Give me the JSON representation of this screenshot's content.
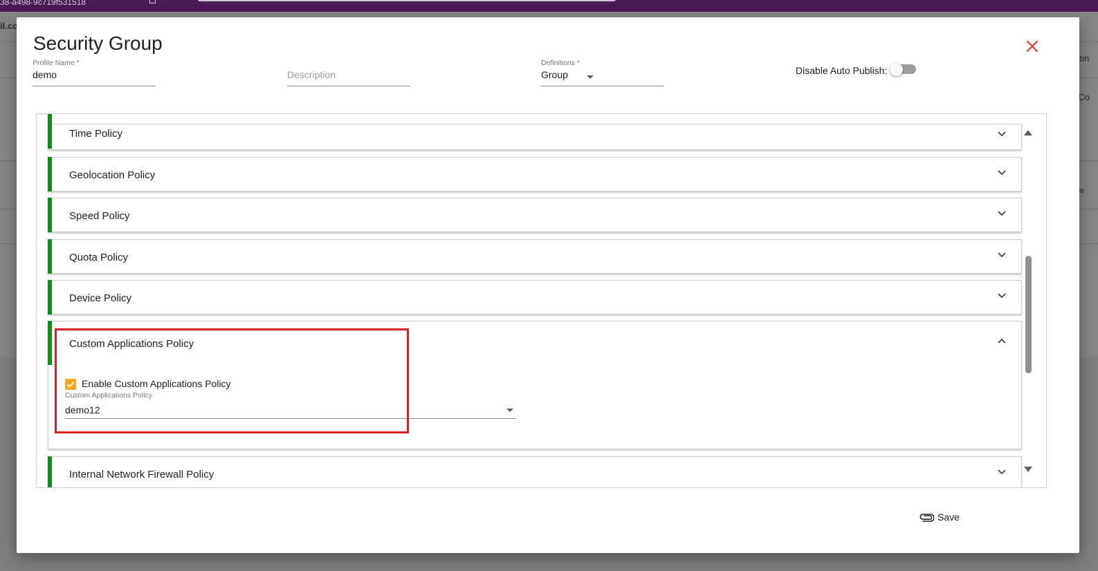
{
  "backdrop": {
    "top_id_fragment": "38-a498-9c719f531518",
    "left_fragment": "il.co",
    "right_fragments": [
      "Settin",
      "ch Co",
      "odifie"
    ]
  },
  "dialog": {
    "title": "Security Group",
    "close_icon": "close-icon",
    "accent_color": "#138a1a",
    "close_color": "#e53935"
  },
  "form": {
    "profile_name": {
      "label": "Profile Name *",
      "value": "demo"
    },
    "description": {
      "placeholder": "Description",
      "value": ""
    },
    "definitions": {
      "label": "Definitions *",
      "value": "Group"
    },
    "auto_publish": {
      "label": "Disable Auto Publish:",
      "enabled": false
    }
  },
  "policies": [
    {
      "title": "Time Policy",
      "expanded": false
    },
    {
      "title": "Geolocation Policy",
      "expanded": false
    },
    {
      "title": "Speed Policy",
      "expanded": false
    },
    {
      "title": "Quota Policy",
      "expanded": false
    },
    {
      "title": "Device Policy",
      "expanded": false
    },
    {
      "title": "Custom Applications Policy",
      "expanded": true
    },
    {
      "title": "Internal Network Firewall Policy",
      "expanded": false
    }
  ],
  "custom_app": {
    "checkbox_label": "Enable Custom Applications Policy",
    "checked": true,
    "select_label": "Custom Applications Policy",
    "select_value": "demo12",
    "checkbox_color": "#f6a623"
  },
  "footer": {
    "save_label": "Save",
    "save_icon": "paperclip-icon"
  }
}
